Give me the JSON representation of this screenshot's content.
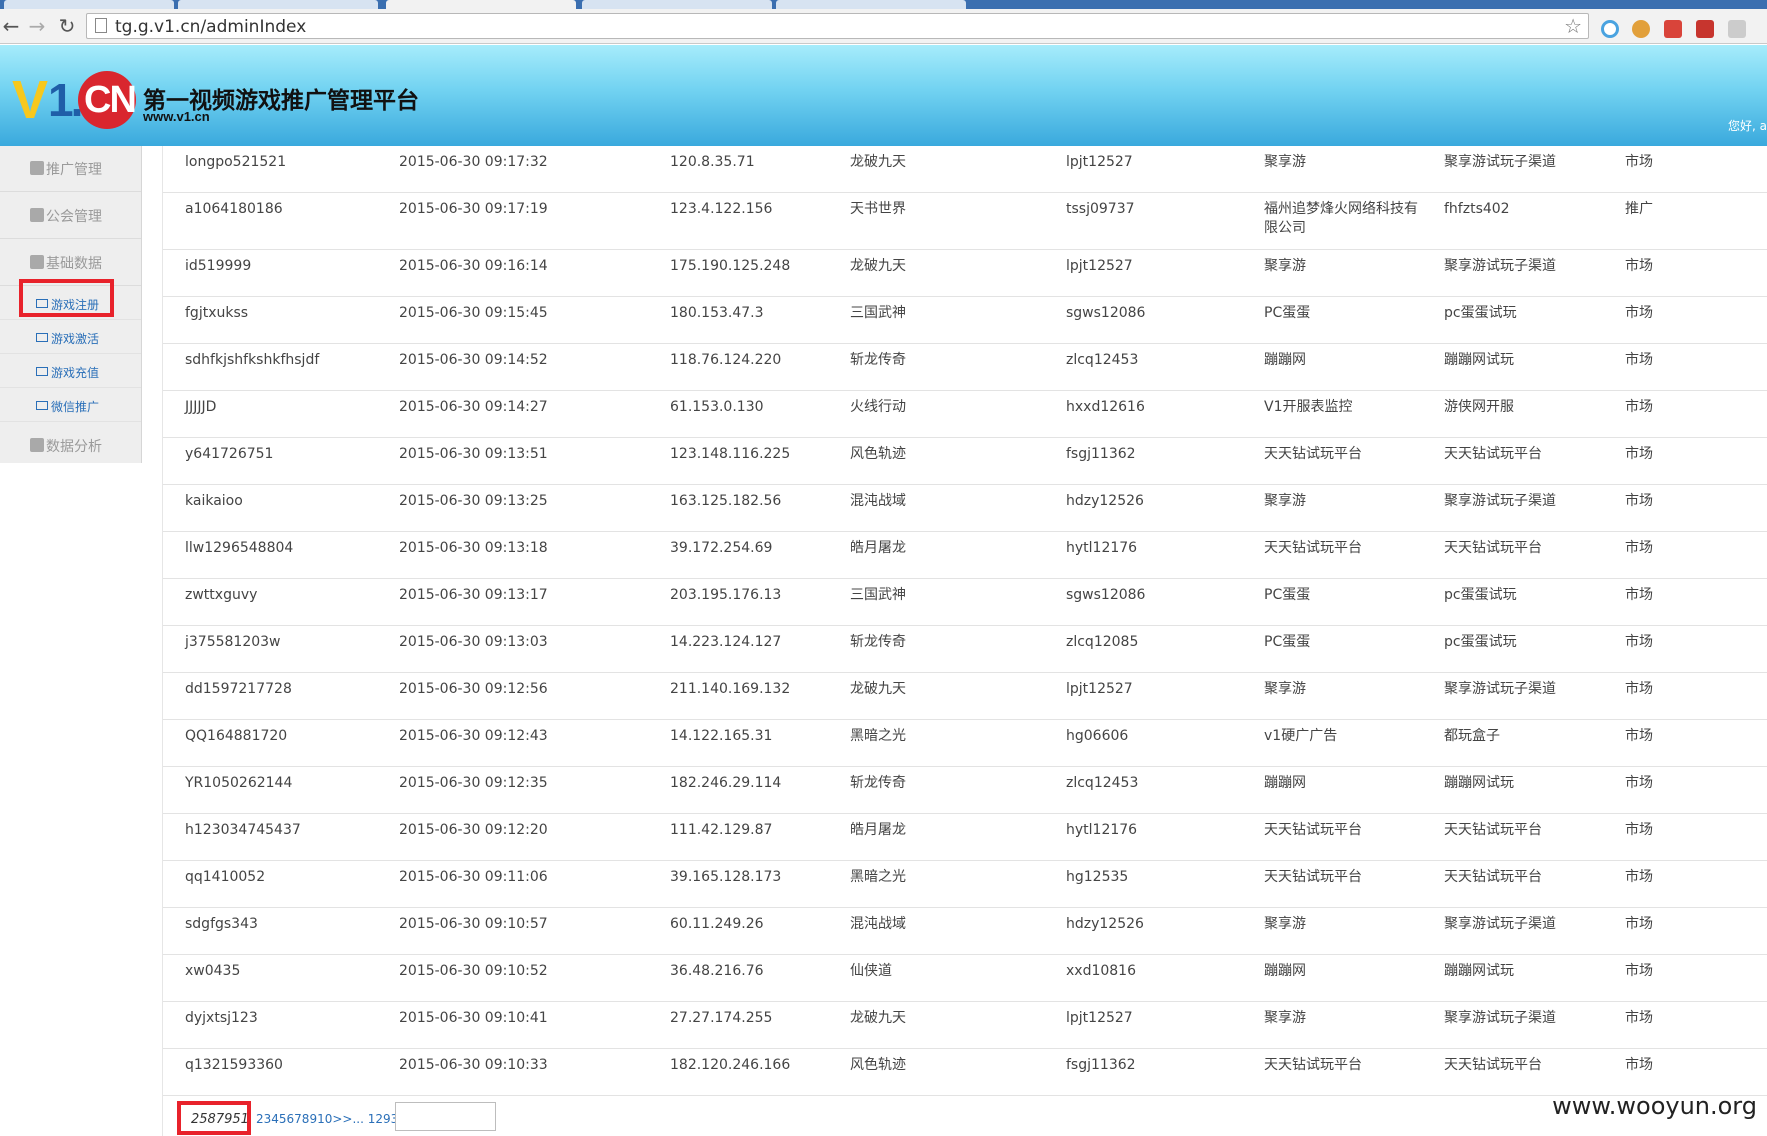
{
  "browser": {
    "url": "tg.g.v1.cn/adminIndex",
    "back_icon": "back-arrow-icon",
    "forward_icon": "forward-arrow-icon",
    "reload_icon": "reload-icon",
    "bookmark_icon": "star-icon"
  },
  "header": {
    "logo": {
      "v": "V",
      "one": "1.",
      "cn": "CN"
    },
    "title": "第一视频游戏推广管理平台",
    "site_url": "www.v1.cn",
    "greeting": "您好, a"
  },
  "sidebar": {
    "groups": [
      {
        "label": "推广管理",
        "icon": "user-icon"
      },
      {
        "label": "公会管理",
        "icon": "group-icon"
      },
      {
        "label": "基础数据",
        "icon": "book-icon"
      },
      {
        "label": "数据分析",
        "icon": "book-icon"
      }
    ],
    "subitems": [
      {
        "label": "游戏注册",
        "icon": "list-icon",
        "highlighted": true
      },
      {
        "label": "游戏激活",
        "icon": "list-icon"
      },
      {
        "label": "游戏充值",
        "icon": "list-icon"
      },
      {
        "label": "微信推广",
        "icon": "list-icon"
      }
    ]
  },
  "table": {
    "rows": [
      [
        "longpo521521",
        "2015-06-30 09:17:32",
        "120.8.35.71",
        "龙破九天",
        "lpjt12527",
        "聚享游",
        "聚享游试玩子渠道",
        "市场"
      ],
      [
        "a1064180186",
        "2015-06-30 09:17:19",
        "123.4.122.156",
        "天书世界",
        "tssj09737",
        "福州追梦烽火网络科技有限公司",
        "fhfzts402",
        "推广"
      ],
      [
        "id519999",
        "2015-06-30 09:16:14",
        "175.190.125.248",
        "龙破九天",
        "lpjt12527",
        "聚享游",
        "聚享游试玩子渠道",
        "市场"
      ],
      [
        "fgjtxukss",
        "2015-06-30 09:15:45",
        "180.153.47.3",
        "三国武神",
        "sgws12086",
        "PC蛋蛋",
        "pc蛋蛋试玩",
        "市场"
      ],
      [
        "sdhfkjshfkshkfhsjdf",
        "2015-06-30 09:14:52",
        "118.76.124.220",
        "斩龙传奇",
        "zlcq12453",
        "蹦蹦网",
        "蹦蹦网试玩",
        "市场"
      ],
      [
        "JJJJJD",
        "2015-06-30 09:14:27",
        "61.153.0.130",
        "火线行动",
        "hxxd12616",
        "V1开服表监控",
        "游侠网开服",
        "市场"
      ],
      [
        "y641726751",
        "2015-06-30 09:13:51",
        "123.148.116.225",
        "风色轨迹",
        "fsgj11362",
        "天天钻试玩平台",
        "天天钻试玩平台",
        "市场"
      ],
      [
        "kaikaioo",
        "2015-06-30 09:13:25",
        "163.125.182.56",
        "混沌战域",
        "hdzy12526",
        "聚享游",
        "聚享游试玩子渠道",
        "市场"
      ],
      [
        "llw1296548804",
        "2015-06-30 09:13:18",
        "39.172.254.69",
        "皓月屠龙",
        "hytl12176",
        "天天钻试玩平台",
        "天天钻试玩平台",
        "市场"
      ],
      [
        "zwttxguvy",
        "2015-06-30 09:13:17",
        "203.195.176.13",
        "三国武神",
        "sgws12086",
        "PC蛋蛋",
        "pc蛋蛋试玩",
        "市场"
      ],
      [
        "j375581203w",
        "2015-06-30 09:13:03",
        "14.223.124.127",
        "斩龙传奇",
        "zlcq12085",
        "PC蛋蛋",
        "pc蛋蛋试玩",
        "市场"
      ],
      [
        "dd1597217728",
        "2015-06-30 09:12:56",
        "211.140.169.132",
        "龙破九天",
        "lpjt12527",
        "聚享游",
        "聚享游试玩子渠道",
        "市场"
      ],
      [
        "QQ164881720",
        "2015-06-30 09:12:43",
        "14.122.165.31",
        "黑暗之光",
        "hg06606",
        "v1硬广广告",
        "都玩盒子",
        "市场"
      ],
      [
        "YR1050262144",
        "2015-06-30 09:12:35",
        "182.246.29.114",
        "斩龙传奇",
        "zlcq12453",
        "蹦蹦网",
        "蹦蹦网试玩",
        "市场"
      ],
      [
        "h123034745437",
        "2015-06-30 09:12:20",
        "111.42.129.87",
        "皓月屠龙",
        "hytl12176",
        "天天钻试玩平台",
        "天天钻试玩平台",
        "市场"
      ],
      [
        "qq1410052",
        "2015-06-30 09:11:06",
        "39.165.128.173",
        "黑暗之光",
        "hg12535",
        "天天钻试玩平台",
        "天天钻试玩平台",
        "市场"
      ],
      [
        "sdgfgs343",
        "2015-06-30 09:10:57",
        "60.11.249.26",
        "混沌战域",
        "hdzy12526",
        "聚享游",
        "聚享游试玩子渠道",
        "市场"
      ],
      [
        "xw0435",
        "2015-06-30 09:10:52",
        "36.48.216.76",
        "仙侠道",
        "xxd10816",
        "蹦蹦网",
        "蹦蹦网试玩",
        "市场"
      ],
      [
        "dyjxtsj123",
        "2015-06-30 09:10:41",
        "27.27.174.255",
        "龙破九天",
        "lpjt12527",
        "聚享游",
        "聚享游试玩子渠道",
        "市场"
      ],
      [
        "q1321593360",
        "2015-06-30 09:10:33",
        "182.120.246.166",
        "风色轨迹",
        "fsgj11362",
        "天天钻试玩平台",
        "天天钻试玩平台",
        "市场"
      ]
    ]
  },
  "pagination": {
    "total": "2587951",
    "links": "2345678910>>... 129398",
    "jump_input_value": ""
  },
  "watermark": "www.wooyun.org",
  "colors": {
    "highlight": "#e8222b",
    "link": "#2a6fb8",
    "header_top": "#a6ecfb",
    "header_bottom": "#3aa9dd"
  }
}
